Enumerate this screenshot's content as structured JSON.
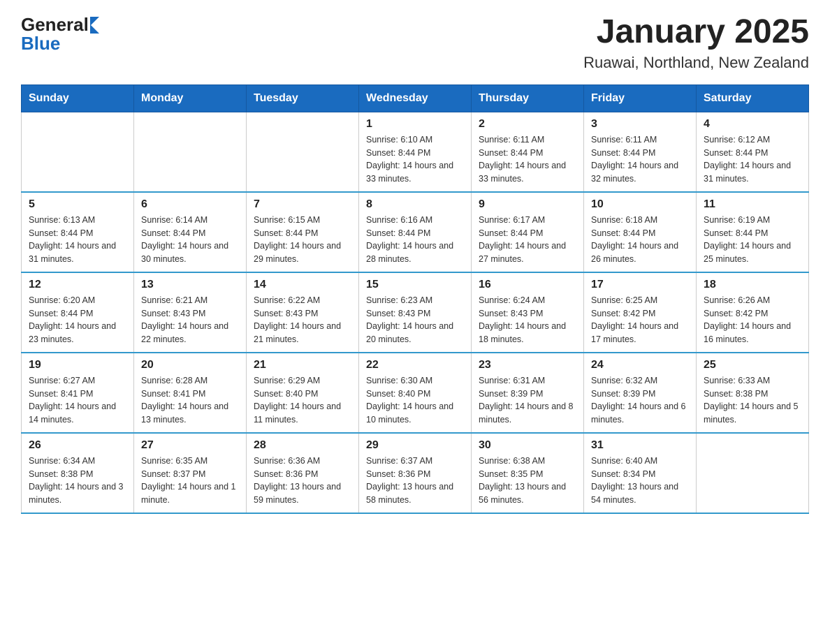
{
  "header": {
    "logo": {
      "general": "General",
      "blue": "Blue"
    },
    "title": "January 2025",
    "subtitle": "Ruawai, Northland, New Zealand"
  },
  "days_of_week": [
    "Sunday",
    "Monday",
    "Tuesday",
    "Wednesday",
    "Thursday",
    "Friday",
    "Saturday"
  ],
  "weeks": [
    [
      {
        "num": "",
        "info": ""
      },
      {
        "num": "",
        "info": ""
      },
      {
        "num": "",
        "info": ""
      },
      {
        "num": "1",
        "info": "Sunrise: 6:10 AM\nSunset: 8:44 PM\nDaylight: 14 hours and 33 minutes."
      },
      {
        "num": "2",
        "info": "Sunrise: 6:11 AM\nSunset: 8:44 PM\nDaylight: 14 hours and 33 minutes."
      },
      {
        "num": "3",
        "info": "Sunrise: 6:11 AM\nSunset: 8:44 PM\nDaylight: 14 hours and 32 minutes."
      },
      {
        "num": "4",
        "info": "Sunrise: 6:12 AM\nSunset: 8:44 PM\nDaylight: 14 hours and 31 minutes."
      }
    ],
    [
      {
        "num": "5",
        "info": "Sunrise: 6:13 AM\nSunset: 8:44 PM\nDaylight: 14 hours and 31 minutes."
      },
      {
        "num": "6",
        "info": "Sunrise: 6:14 AM\nSunset: 8:44 PM\nDaylight: 14 hours and 30 minutes."
      },
      {
        "num": "7",
        "info": "Sunrise: 6:15 AM\nSunset: 8:44 PM\nDaylight: 14 hours and 29 minutes."
      },
      {
        "num": "8",
        "info": "Sunrise: 6:16 AM\nSunset: 8:44 PM\nDaylight: 14 hours and 28 minutes."
      },
      {
        "num": "9",
        "info": "Sunrise: 6:17 AM\nSunset: 8:44 PM\nDaylight: 14 hours and 27 minutes."
      },
      {
        "num": "10",
        "info": "Sunrise: 6:18 AM\nSunset: 8:44 PM\nDaylight: 14 hours and 26 minutes."
      },
      {
        "num": "11",
        "info": "Sunrise: 6:19 AM\nSunset: 8:44 PM\nDaylight: 14 hours and 25 minutes."
      }
    ],
    [
      {
        "num": "12",
        "info": "Sunrise: 6:20 AM\nSunset: 8:44 PM\nDaylight: 14 hours and 23 minutes."
      },
      {
        "num": "13",
        "info": "Sunrise: 6:21 AM\nSunset: 8:43 PM\nDaylight: 14 hours and 22 minutes."
      },
      {
        "num": "14",
        "info": "Sunrise: 6:22 AM\nSunset: 8:43 PM\nDaylight: 14 hours and 21 minutes."
      },
      {
        "num": "15",
        "info": "Sunrise: 6:23 AM\nSunset: 8:43 PM\nDaylight: 14 hours and 20 minutes."
      },
      {
        "num": "16",
        "info": "Sunrise: 6:24 AM\nSunset: 8:43 PM\nDaylight: 14 hours and 18 minutes."
      },
      {
        "num": "17",
        "info": "Sunrise: 6:25 AM\nSunset: 8:42 PM\nDaylight: 14 hours and 17 minutes."
      },
      {
        "num": "18",
        "info": "Sunrise: 6:26 AM\nSunset: 8:42 PM\nDaylight: 14 hours and 16 minutes."
      }
    ],
    [
      {
        "num": "19",
        "info": "Sunrise: 6:27 AM\nSunset: 8:41 PM\nDaylight: 14 hours and 14 minutes."
      },
      {
        "num": "20",
        "info": "Sunrise: 6:28 AM\nSunset: 8:41 PM\nDaylight: 14 hours and 13 minutes."
      },
      {
        "num": "21",
        "info": "Sunrise: 6:29 AM\nSunset: 8:40 PM\nDaylight: 14 hours and 11 minutes."
      },
      {
        "num": "22",
        "info": "Sunrise: 6:30 AM\nSunset: 8:40 PM\nDaylight: 14 hours and 10 minutes."
      },
      {
        "num": "23",
        "info": "Sunrise: 6:31 AM\nSunset: 8:39 PM\nDaylight: 14 hours and 8 minutes."
      },
      {
        "num": "24",
        "info": "Sunrise: 6:32 AM\nSunset: 8:39 PM\nDaylight: 14 hours and 6 minutes."
      },
      {
        "num": "25",
        "info": "Sunrise: 6:33 AM\nSunset: 8:38 PM\nDaylight: 14 hours and 5 minutes."
      }
    ],
    [
      {
        "num": "26",
        "info": "Sunrise: 6:34 AM\nSunset: 8:38 PM\nDaylight: 14 hours and 3 minutes."
      },
      {
        "num": "27",
        "info": "Sunrise: 6:35 AM\nSunset: 8:37 PM\nDaylight: 14 hours and 1 minute."
      },
      {
        "num": "28",
        "info": "Sunrise: 6:36 AM\nSunset: 8:36 PM\nDaylight: 13 hours and 59 minutes."
      },
      {
        "num": "29",
        "info": "Sunrise: 6:37 AM\nSunset: 8:36 PM\nDaylight: 13 hours and 58 minutes."
      },
      {
        "num": "30",
        "info": "Sunrise: 6:38 AM\nSunset: 8:35 PM\nDaylight: 13 hours and 56 minutes."
      },
      {
        "num": "31",
        "info": "Sunrise: 6:40 AM\nSunset: 8:34 PM\nDaylight: 13 hours and 54 minutes."
      },
      {
        "num": "",
        "info": ""
      }
    ]
  ]
}
